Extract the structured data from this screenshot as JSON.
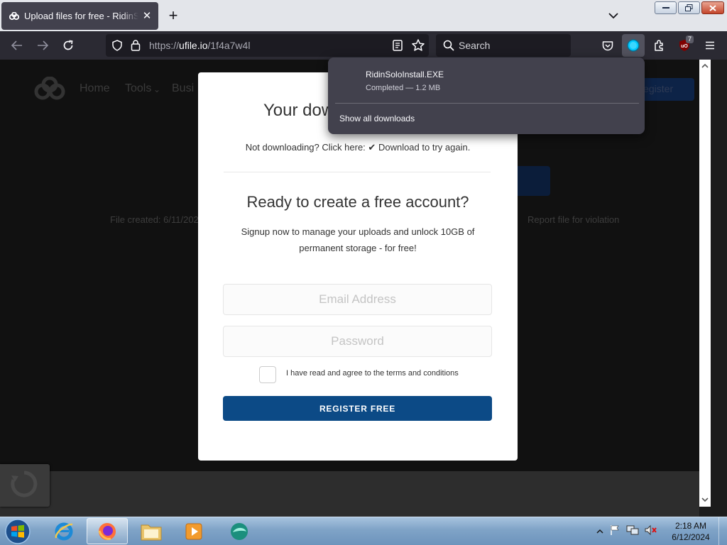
{
  "browser": {
    "tab": {
      "title": "Upload files for free - RidinSolo",
      "close_symbol": "✕"
    },
    "new_tab_symbol": "+",
    "url": {
      "scheme": "https://",
      "host": "ufile.io",
      "path": "/1f4a7w4l"
    },
    "search_placeholder": "Search",
    "extension_badge": "7",
    "icons": [
      "back-arrow-icon",
      "forward-arrow-icon",
      "reload-icon",
      "shield-icon",
      "lock-icon",
      "reader-view-icon",
      "bookmark-star-icon",
      "search-icon",
      "pocket-icon",
      "downloads-icon",
      "extensions-icon",
      "ublock-icon",
      "menu-icon"
    ]
  },
  "downloads_panel": {
    "file_name": "RidinSoloInstall.EXE",
    "status": "Completed — 1.2 MB",
    "show_all": "Show all downloads"
  },
  "page": {
    "background_nav": [
      "Home",
      "Tools",
      "Busi"
    ],
    "background_register": "Register",
    "background_left_text": "File created: 6/11/202",
    "background_right_text": "Report file for violation"
  },
  "modal": {
    "heading": "Your dow",
    "retry_text_prefix": "Not downloading? Click here:",
    "retry_check": "✔",
    "retry_link": "Download to try again.",
    "cta_title": "Ready to create a free account?",
    "cta_description": "Signup now to manage your uploads and unlock 10GB of permanent storage - for free!",
    "email_placeholder": "Email Address",
    "password_placeholder": "Password",
    "terms_label": "I have read and agree to the terms and conditions",
    "register_label": "REGISTER FREE"
  },
  "colors": {
    "register_button": "#0c4a86",
    "downloads_panel": "#42414d",
    "toolbar": "#2b2a33",
    "downloads_icon_accent": "#00c8ff"
  },
  "taskbar": {
    "apps": [
      "internet-explorer",
      "firefox",
      "file-explorer",
      "media-player",
      "browser-app"
    ],
    "time": "2:18 AM",
    "date": "6/12/2024"
  }
}
